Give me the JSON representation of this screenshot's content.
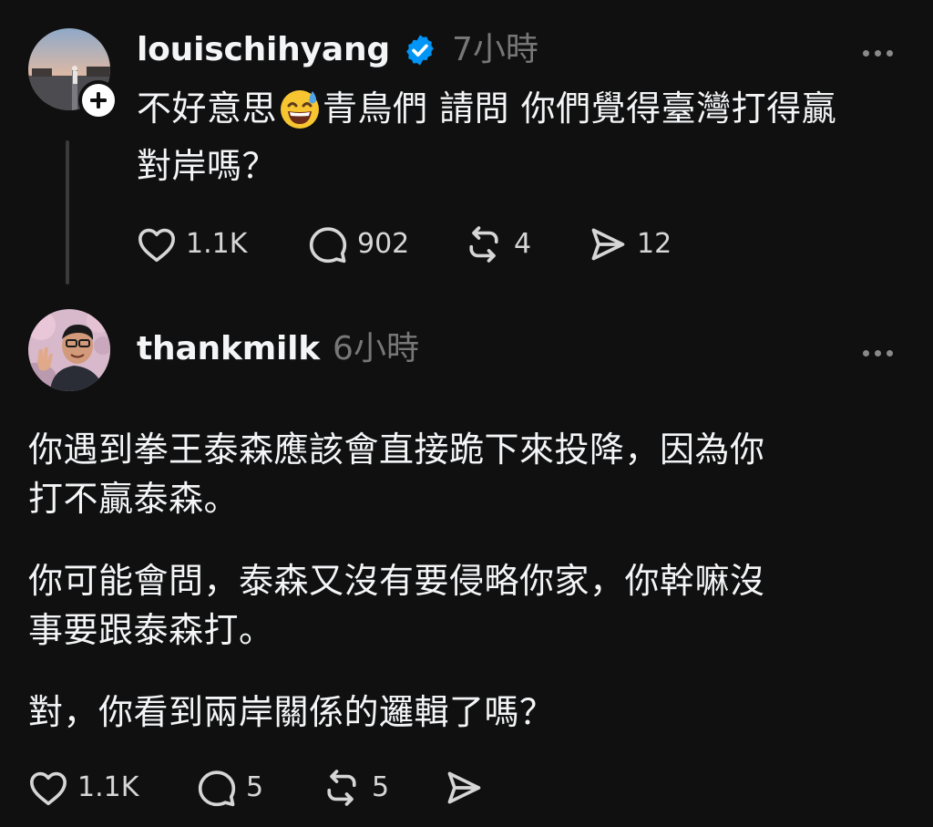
{
  "post": {
    "username": "louischihyang",
    "verified": true,
    "time": "7小時",
    "text_before_emoji": "不好意思",
    "emoji": "grinning-face-with-sweat",
    "text_line1_after_emoji": "青鳥們 請問 你們覺得臺灣打得贏",
    "text_line2": "對岸嗎？",
    "actions": {
      "like_count": "1.1K",
      "comment_count": "902",
      "repost_count": "4",
      "share_count": "12"
    }
  },
  "reply": {
    "username": "thankmilk",
    "time": "6小時",
    "paragraphs": [
      {
        "line1": "你遇到拳王泰森應該會直接跪下來投降，因為你",
        "line2": "打不贏泰森。"
      },
      {
        "line1": "你可能會問，泰森又沒有要侵略你家，你幹嘛沒",
        "line2": "事要跟泰森打。"
      },
      {
        "line1": "對，你看到兩岸關係的邏輯了嗎？",
        "line2": ""
      }
    ],
    "actions": {
      "like_count": "1.1K",
      "comment_count": "5",
      "repost_count": "5"
    }
  },
  "colors": {
    "background": "#101010",
    "text": "#f3f5f7",
    "muted": "#777777",
    "verified": "#0095f6",
    "thread_line": "#3a3a3a"
  },
  "icons": [
    "heart-icon",
    "comment-icon",
    "repost-icon",
    "share-icon",
    "more-icon",
    "verified-badge-icon",
    "plus-icon"
  ]
}
